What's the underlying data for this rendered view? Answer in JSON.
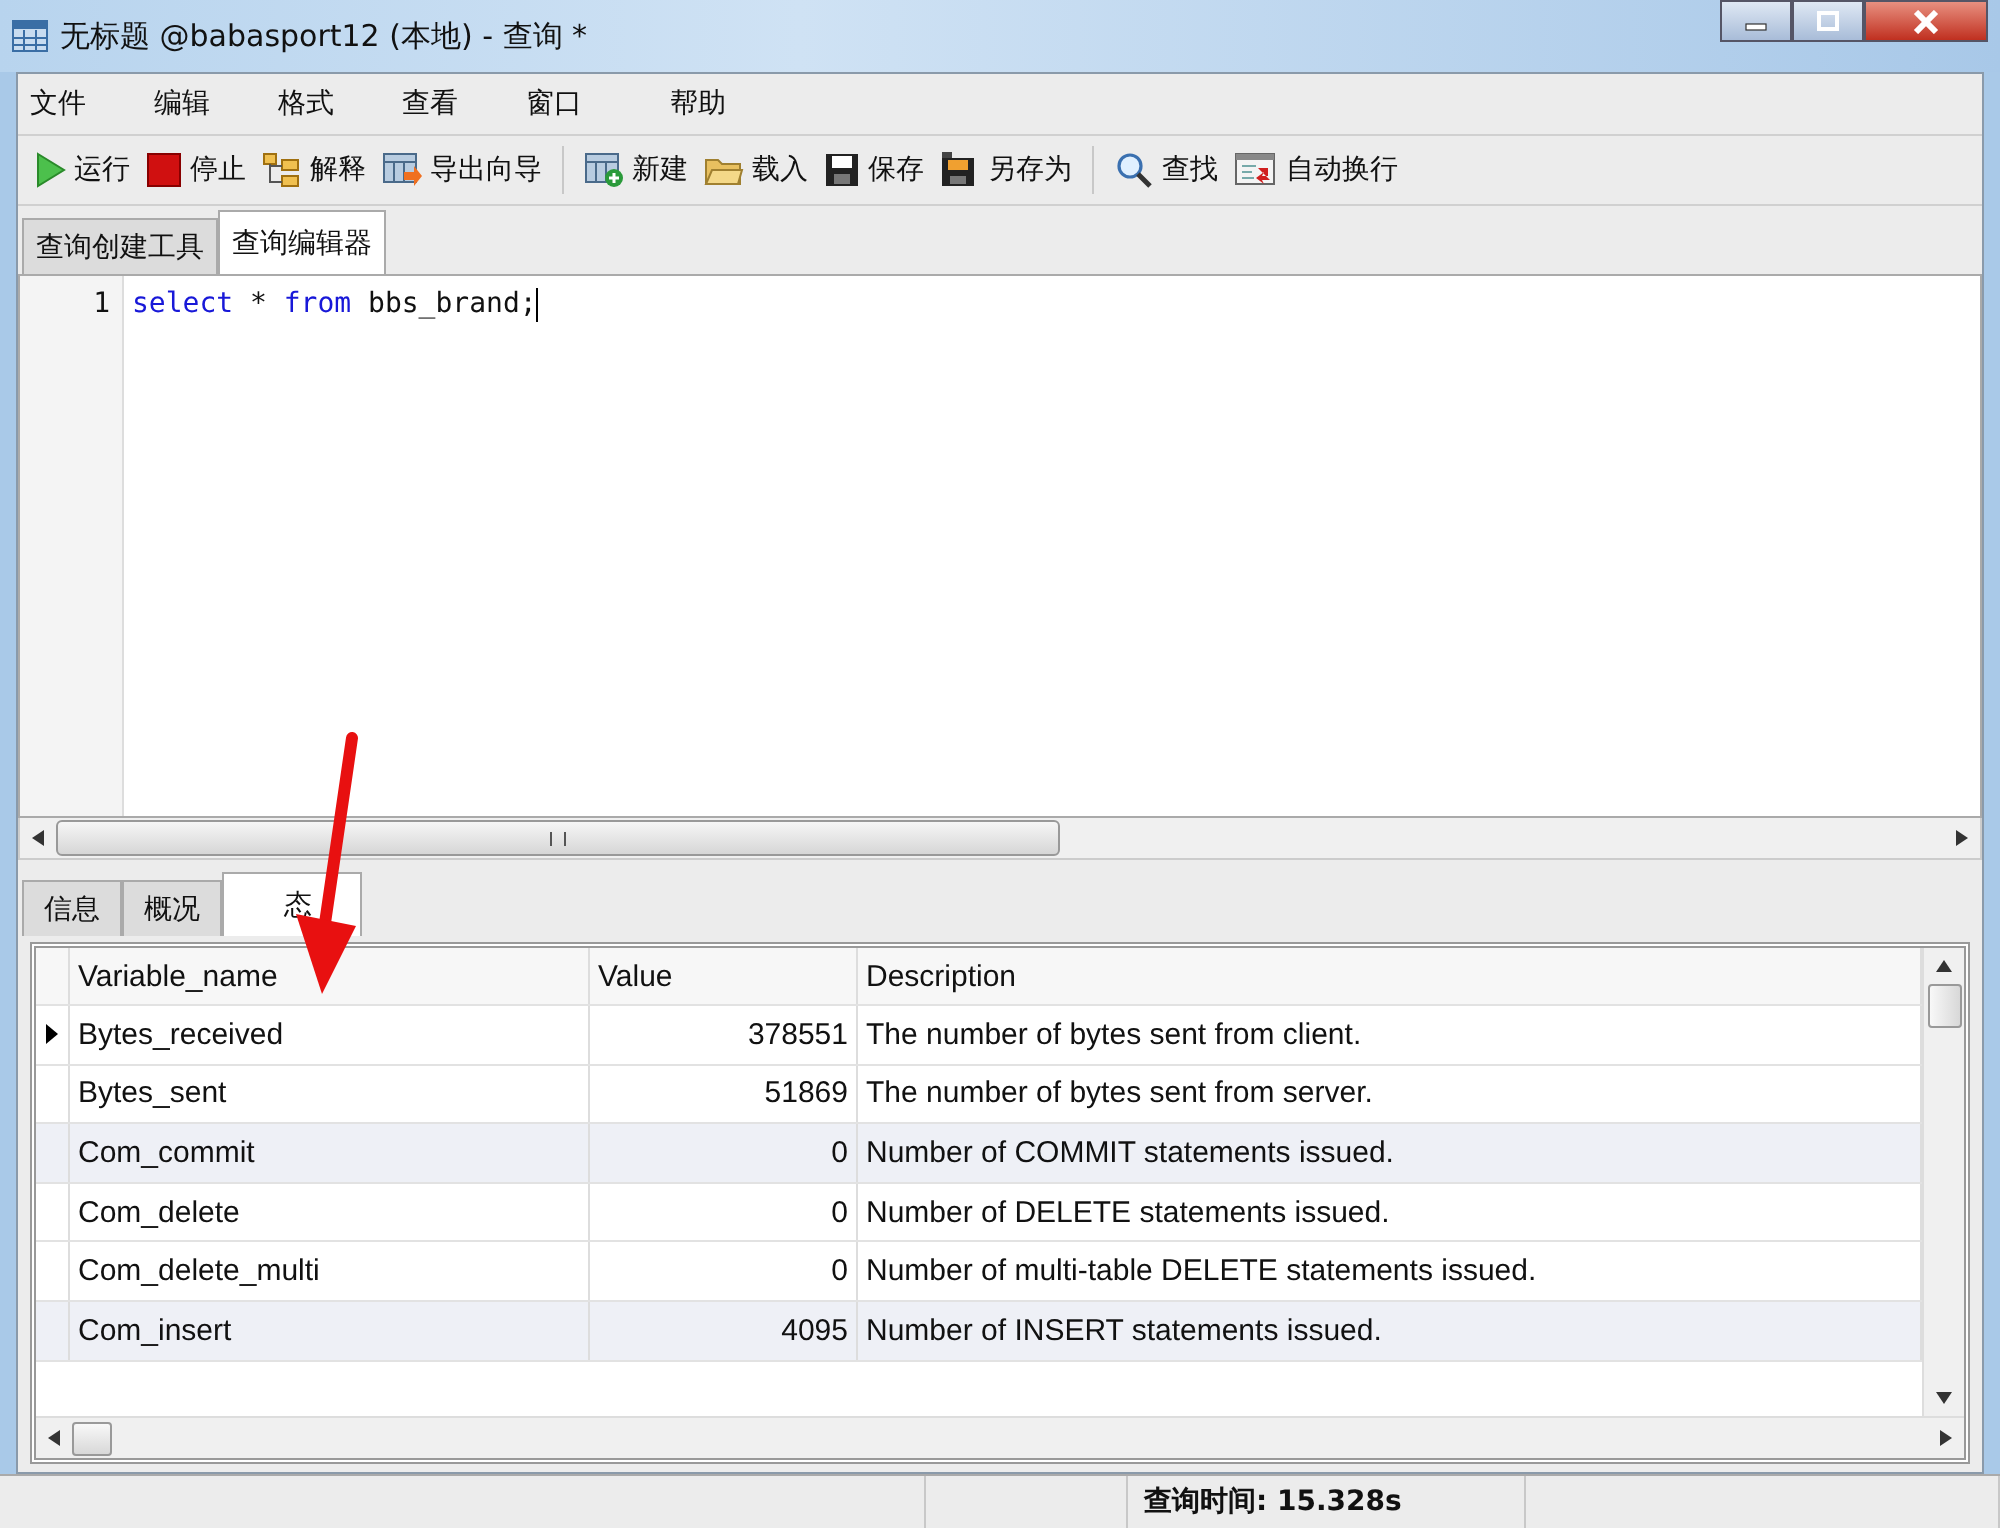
{
  "window": {
    "title": "无标题 @babasport12 (本地) - 查询 *"
  },
  "menu": [
    "文件",
    "编辑",
    "格式",
    "查看",
    "窗口",
    "帮助"
  ],
  "toolbar": [
    {
      "label": "运行",
      "kind": "button"
    },
    {
      "label": "停止",
      "kind": "button"
    },
    {
      "label": "解释",
      "kind": "button"
    },
    {
      "label": "导出向导",
      "kind": "button"
    },
    {
      "kind": "separator"
    },
    {
      "label": "新建",
      "kind": "button"
    },
    {
      "label": "载入",
      "kind": "button"
    },
    {
      "label": "保存",
      "kind": "button"
    },
    {
      "label": "另存为",
      "kind": "button"
    },
    {
      "kind": "separator"
    },
    {
      "label": "查找",
      "kind": "button"
    },
    {
      "label": "自动换行",
      "kind": "button"
    }
  ],
  "editor_tabs": [
    {
      "label": "查询创建工具",
      "selected": false
    },
    {
      "label": "查询编辑器",
      "selected": true
    }
  ],
  "editor": {
    "line_number": "1",
    "tokens": [
      {
        "text": "select",
        "kind": "keyword"
      },
      {
        "text": " * ",
        "kind": "plain"
      },
      {
        "text": "from",
        "kind": "keyword"
      },
      {
        "text": " bbs_brand;",
        "kind": "plain"
      }
    ]
  },
  "result_tabs": [
    {
      "label": "信息",
      "selected": false
    },
    {
      "label": "概况",
      "selected": false
    },
    {
      "label": "态",
      "selected": true
    }
  ],
  "table": {
    "columns": [
      "Variable_name",
      "Value",
      "Description"
    ],
    "rows": [
      {
        "cells": [
          "Bytes_received",
          "378551",
          "The number of bytes sent from client."
        ],
        "selected": true,
        "shaded": false
      },
      {
        "cells": [
          "Bytes_sent",
          "51869",
          "The number of bytes sent from server."
        ],
        "selected": false,
        "shaded": false
      },
      {
        "cells": [
          "Com_commit",
          "0",
          "Number of COMMIT statements issued."
        ],
        "selected": false,
        "shaded": true
      },
      {
        "cells": [
          "Com_delete",
          "0",
          "Number of DELETE statements issued."
        ],
        "selected": false,
        "shaded": false
      },
      {
        "cells": [
          "Com_delete_multi",
          "0",
          "Number of multi-table DELETE statements issued."
        ],
        "selected": false,
        "shaded": false
      },
      {
        "cells": [
          "Com_insert",
          "4095",
          "Number of INSERT statements issued."
        ],
        "selected": false,
        "shaded": true
      }
    ]
  },
  "status_bar": {
    "query_time": "查询时间: 15.328s"
  }
}
